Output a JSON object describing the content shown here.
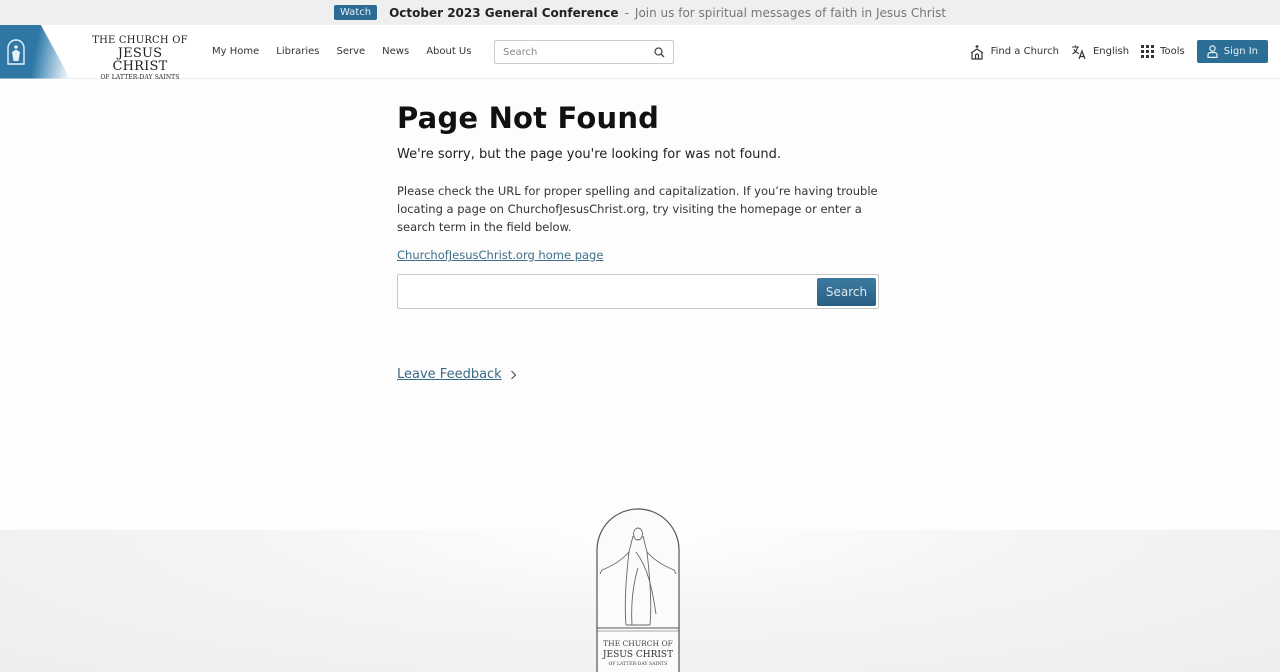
{
  "banner": {
    "watch_label": "Watch",
    "title": "October 2023 General Conference",
    "separator": "-",
    "subtitle": "Join us for spiritual messages of faith in Jesus Christ"
  },
  "header": {
    "logo": {
      "line1": "THE CHURCH OF",
      "line2": "JESUS CHRIST",
      "line3": "OF LATTER-DAY SAINTS",
      "icon": "christus-statue-icon"
    },
    "nav": [
      {
        "label": "My Home"
      },
      {
        "label": "Libraries"
      },
      {
        "label": "Serve"
      },
      {
        "label": "News"
      },
      {
        "label": "About Us"
      }
    ],
    "search": {
      "placeholder": "Search",
      "value": "",
      "icon": "search-icon"
    },
    "right": {
      "find_church": {
        "label": "Find a Church",
        "icon": "church-icon"
      },
      "language": {
        "label": "English",
        "icon": "translate-icon"
      },
      "tools": {
        "label": "Tools",
        "icon": "grid-icon"
      },
      "sign_in": {
        "label": "Sign In",
        "icon": "user-icon"
      }
    },
    "colors": {
      "accent": "#2b6f96"
    }
  },
  "main": {
    "title": "Page Not Found",
    "lead": "We're sorry, but the page you're looking for was not found.",
    "body": "Please check the URL for proper spelling and capitalization. If you’re having trouble locating a page on ChurchofJesusChrist.org, try visiting the homepage or enter a search term in the field below.",
    "home_link": "ChurchofJesusChrist.org home page",
    "search": {
      "value": "",
      "placeholder": "",
      "button_label": "Search"
    },
    "feedback_label": "Leave Feedback"
  },
  "footer": {
    "emblem": {
      "line1": "THE CHURCH OF",
      "line2": "JESUS CHRIST",
      "line3": "OF LATTER-DAY SAINTS"
    }
  }
}
